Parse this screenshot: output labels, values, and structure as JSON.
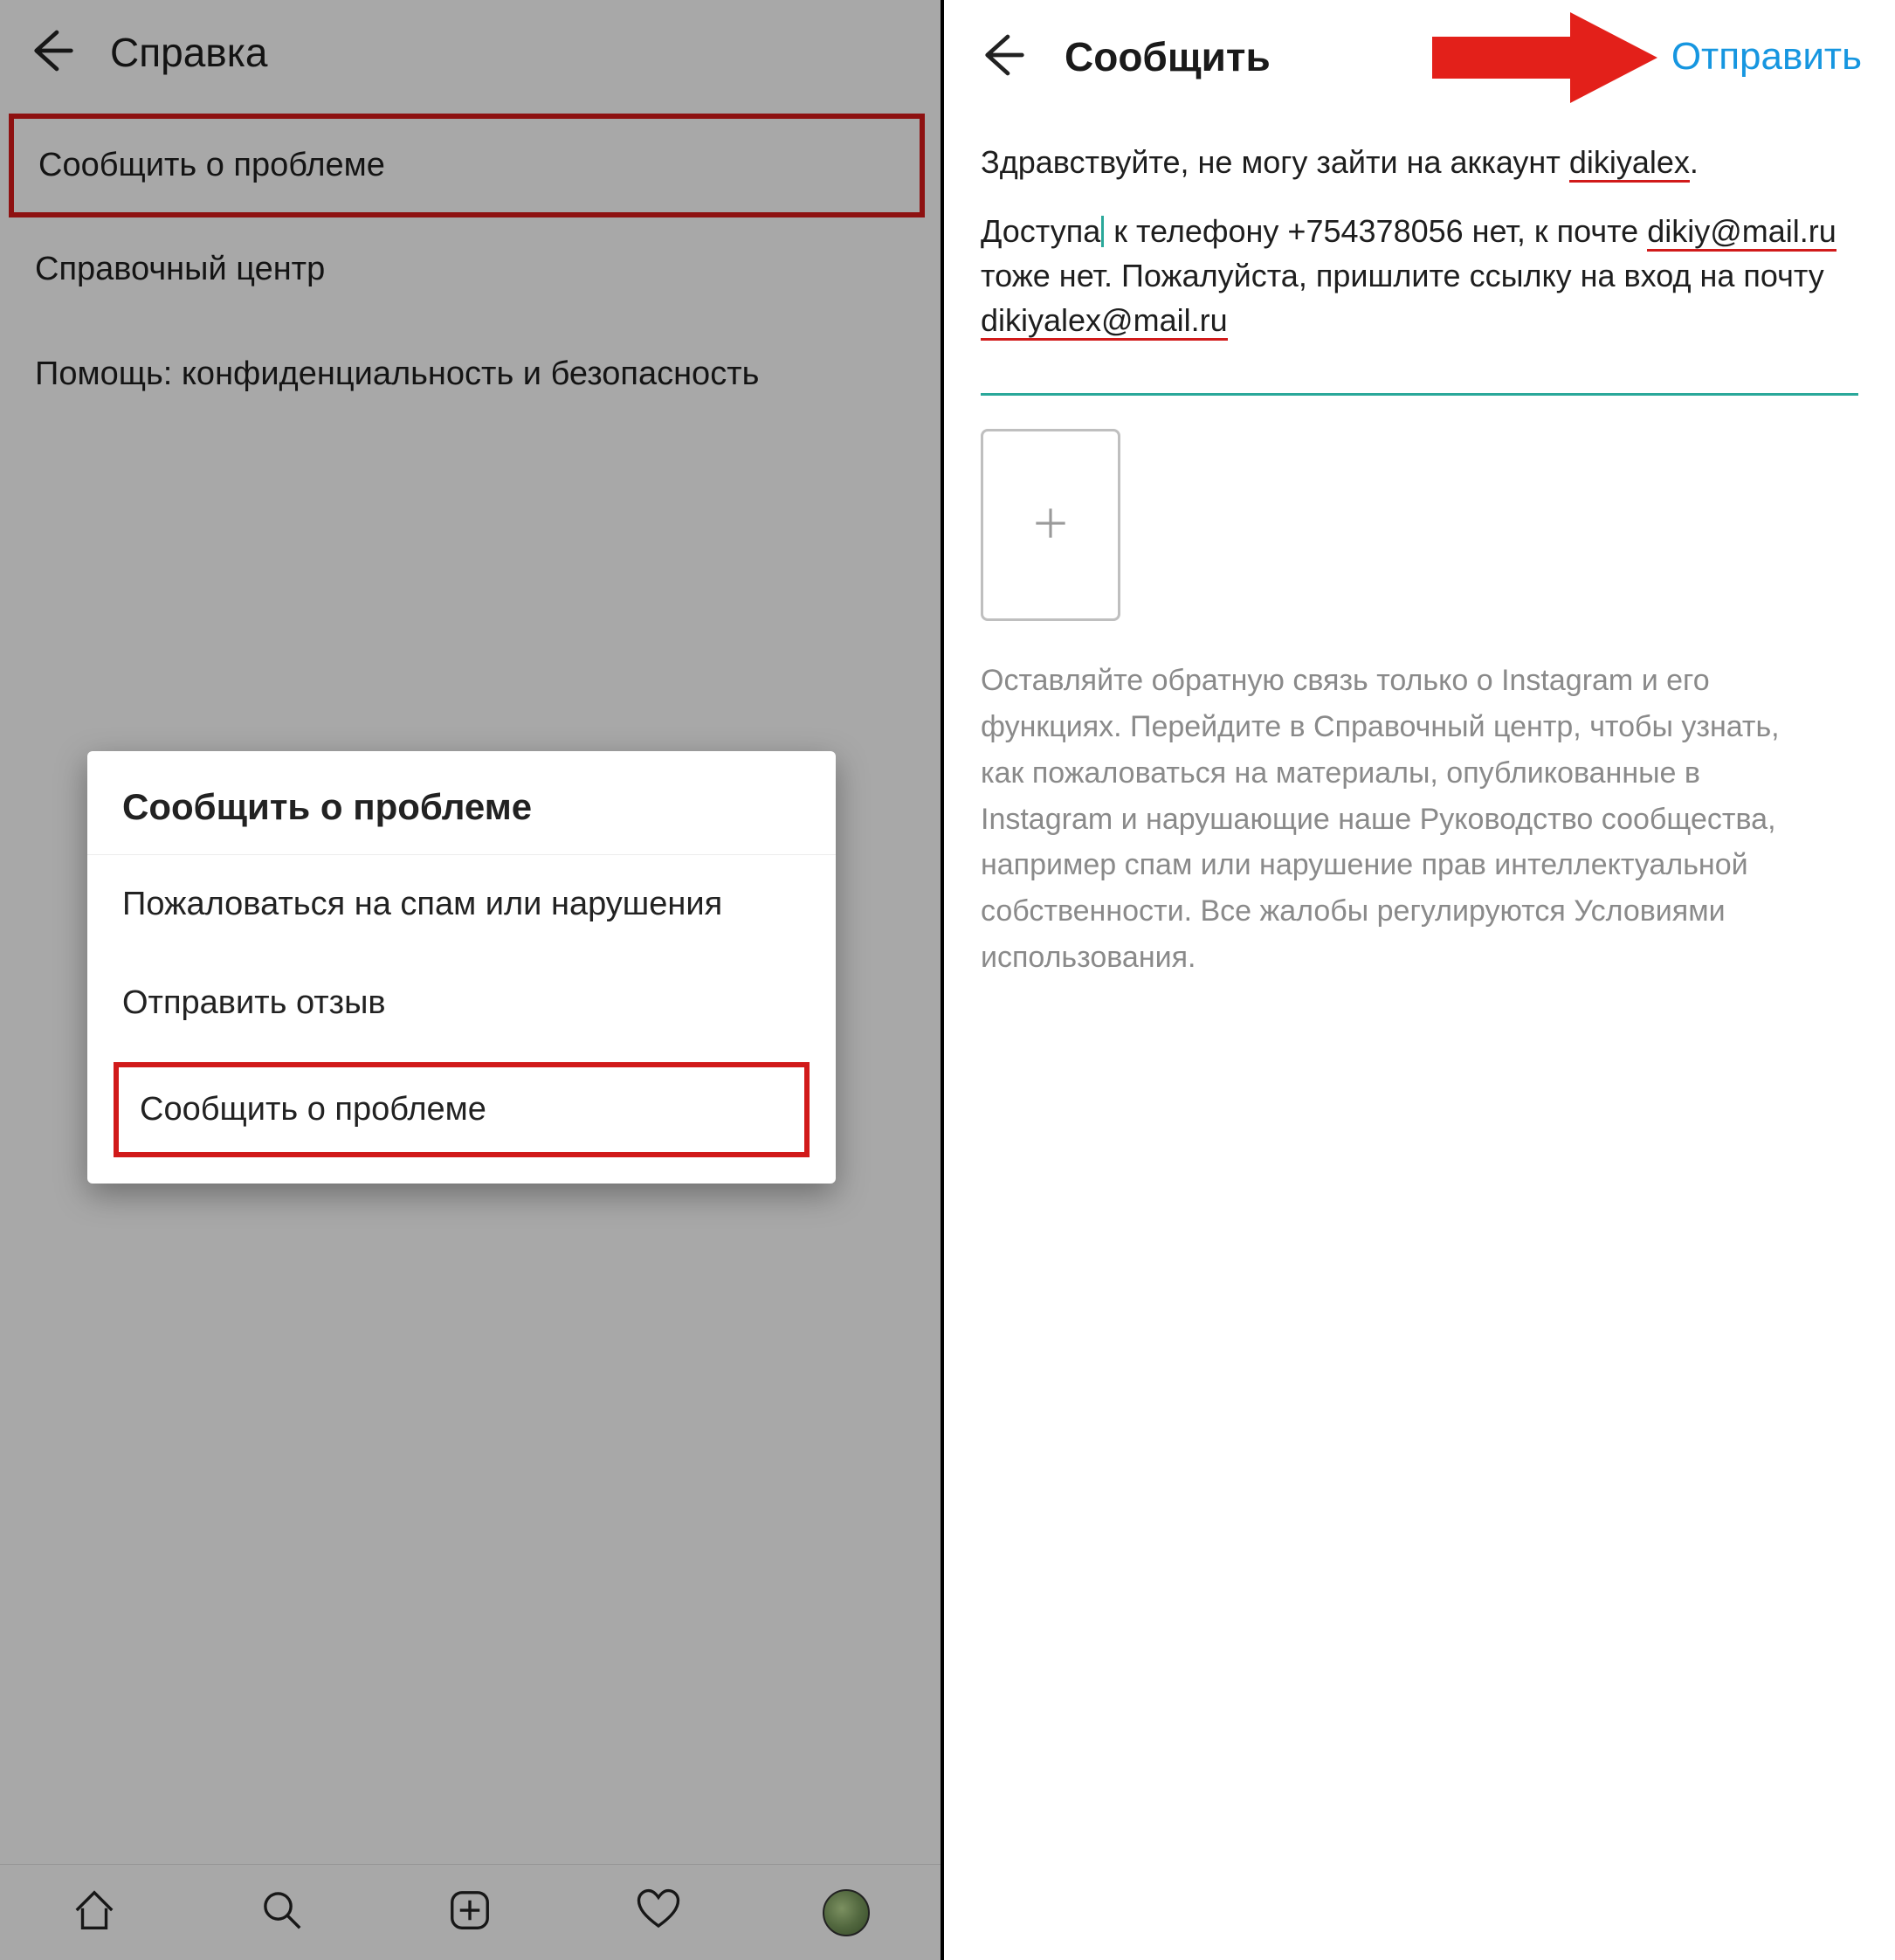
{
  "left": {
    "header_title": "Справка",
    "items": {
      "report_problem": "Сообщить  о проблеме",
      "help_center": "Справочный центр",
      "privacy_security": "Помощь: конфиденциальность и безопасность"
    }
  },
  "modal": {
    "title": "Сообщить  о проблеме",
    "spam": "Пожаловаться на спам или нарушения",
    "feedback": "Отправить отзыв",
    "report": "Сообщить о проблеме"
  },
  "right": {
    "header_title": "Сообщить",
    "submit_label": "Отправить",
    "msg": {
      "line1_a": "Здравствуйте, не могу зайти на аккаунт ",
      "line1_b": "dikiyalex",
      "line1_c": ".",
      "line2_a": "Доступа",
      "line2_b": " к телефону +754378056 нет, к почте ",
      "line2_c": "dikiy@mail.ru",
      "line2_d": " тоже нет. Пожалуйста, пришлите ссылку на вход на почту ",
      "line2_e": "dikiyalex@mail.ru"
    },
    "hint": "Оставляйте обратную связь только о Instagram и его функциях. Перейдите в Справочный центр, чтобы узнать, как пожаловаться на материалы, опубликованные в Instagram и нарушающие наше Руководство сообщества, например спам или нарушение прав интеллектуальной собственности. Все жалобы регулируются Условиями использования."
  },
  "colors": {
    "highlight": "#d11a1a",
    "accent_link": "#1696e0",
    "teal": "#2aa89a"
  }
}
